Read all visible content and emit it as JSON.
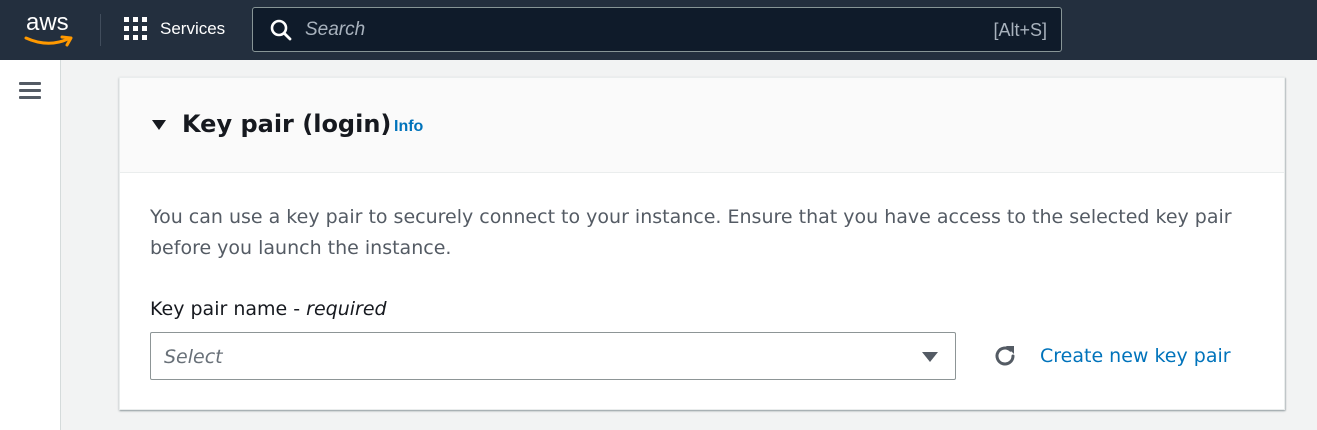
{
  "topnav": {
    "logo_text": "aws",
    "services_label": "Services",
    "search": {
      "placeholder": "Search",
      "value": "",
      "shortcut": "[Alt+S]"
    },
    "colors": {
      "background": "#232f3e",
      "logo_smile": "#ff9900"
    }
  },
  "leftrail": {
    "menu_icon": "hamburger-menu-icon"
  },
  "panel": {
    "title": "Key pair (login)",
    "info_link": "Info",
    "description": "You can use a key pair to securely connect to your instance. Ensure that you have access to the selected key pair before you launch the instance.",
    "field": {
      "label": "Key pair name",
      "separator": " - ",
      "required_text": "required",
      "select_placeholder": "Select",
      "selected_value": ""
    },
    "refresh_icon": "refresh-icon",
    "create_link": "Create new key pair",
    "colors": {
      "link": "#0073bb",
      "title": "#16191f"
    }
  }
}
